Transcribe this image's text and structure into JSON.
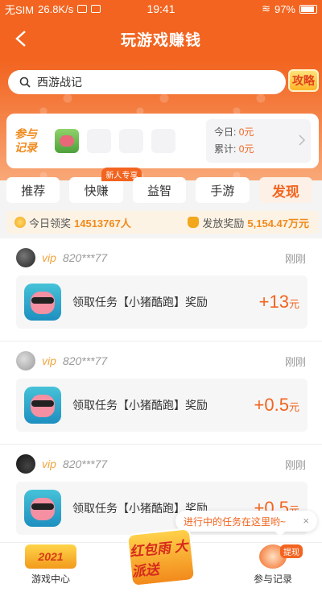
{
  "status_bar": {
    "carrier": "无SIM",
    "speed": "26.8K/s",
    "time": "19:41",
    "battery": "97%"
  },
  "header": {
    "title": "玩游戏赚钱"
  },
  "search": {
    "value": "西游战记",
    "guide_label": "攻略"
  },
  "participation": {
    "label": "参与记录",
    "today_label": "今日:",
    "today_value": "0元",
    "total_label": "累计:",
    "total_value": "0元"
  },
  "tabs": [
    {
      "label": "推荐",
      "active": false
    },
    {
      "label": "快赚",
      "active": false,
      "badge": "新人专享"
    },
    {
      "label": "益智",
      "active": false
    },
    {
      "label": "手游",
      "active": false
    },
    {
      "label": "发现",
      "active": true
    }
  ],
  "award_bar": {
    "today_label": "今日领奖",
    "today_count": "14513767人",
    "paid_label": "发放奖励",
    "paid_value": "5,154.47万元"
  },
  "feed": [
    {
      "vip": "vip",
      "user": "820***77",
      "time": "刚刚",
      "task": "领取任务【小猪酷跑】奖励",
      "reward": "+13",
      "unit": "元"
    },
    {
      "vip": "vip",
      "user": "820***77",
      "time": "刚刚",
      "task": "领取任务【小猪酷跑】奖励",
      "reward": "+0.5",
      "unit": "元"
    },
    {
      "vip": "vip",
      "user": "820***77",
      "time": "刚刚",
      "task": "领取任务【小猪酷跑】奖励",
      "reward": "+0.5",
      "unit": "元"
    }
  ],
  "tooltip": {
    "text": "进行中的任务在这里哟~",
    "close": "×"
  },
  "bottom_nav": {
    "games_label": "游戏中心",
    "games_logo": "2021",
    "center_label": "红包雨 大派送",
    "records_label": "参与记录",
    "records_badge": "提现"
  },
  "colors": {
    "brand": "#f2641f",
    "accent": "#f08a1c"
  }
}
